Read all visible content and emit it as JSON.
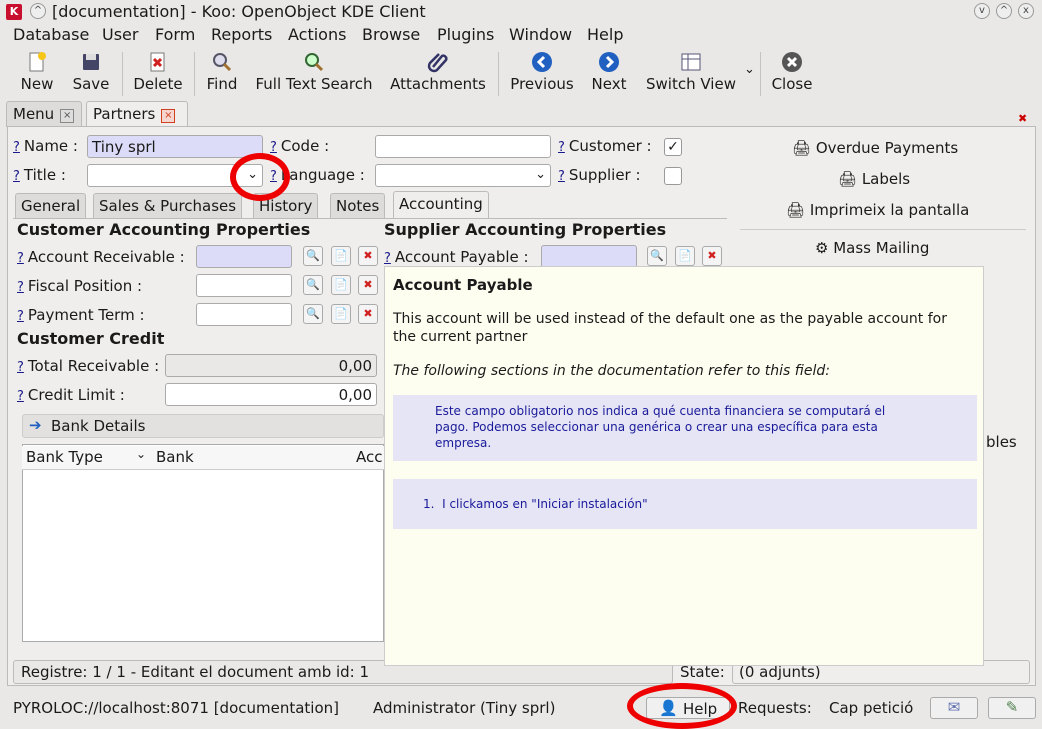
{
  "window": {
    "title": "[documentation] - Koo: OpenObject KDE Client"
  },
  "menu": [
    "Database",
    "User",
    "Form",
    "Reports",
    "Actions",
    "Browse",
    "Plugins",
    "Window",
    "Help"
  ],
  "toolbar": {
    "new": "New",
    "save": "Save",
    "delete": "Delete",
    "find": "Find",
    "full_text_search": "Full Text Search",
    "attachments": "Attachments",
    "previous": "Previous",
    "next": "Next",
    "switch_view": "Switch View",
    "close": "Close"
  },
  "tabs": {
    "menu": "Menu",
    "partners": "Partners"
  },
  "form": {
    "name_label": "Name :",
    "name_value": "Tiny sprl",
    "code_label": "Code :",
    "code_value": "",
    "customer_label": "Customer :",
    "customer_checked": "✓",
    "title_label": "Title :",
    "language_label": "Language :",
    "supplier_label": "Supplier :",
    "q": "?"
  },
  "subtabs": [
    "General",
    "Sales & Purchases",
    "History",
    "Notes",
    "Accounting"
  ],
  "accounting": {
    "customer_heading": "Customer Accounting Properties",
    "account_receivable": "Account Receivable :",
    "fiscal_position": "Fiscal Position :",
    "payment_term": "Payment Term :",
    "supplier_heading": "Supplier Accounting Properties",
    "account_payable": "Account Payable :",
    "credit_heading": "Customer Credit",
    "total_receivable": "Total Receivable :",
    "total_receivable_value": "0,00",
    "credit_limit": "Credit Limit :",
    "credit_limit_value": "0,00",
    "bank_details": "Bank Details",
    "bank_cols": [
      "Bank Type",
      "Bank",
      "Acc"
    ]
  },
  "side": {
    "overdue": "Overdue Payments",
    "labels": "Labels",
    "imprimeix": "Imprimeix la pantalla",
    "mass_mailing": "Mass Mailing",
    "partial_text": "bles"
  },
  "tooltip": {
    "title": "Account Payable",
    "body": "This account will be used instead of the default one as the payable account for the current partner",
    "intro": "The following sections in the documentation refer to this field:",
    "doc1": "Este campo obligatorio nos indica a qué cuenta financiera se computará el pago. Podemos seleccionar una genérica o crear una específica para esta empresa.",
    "doc2_num": "1.",
    "doc2": "I clickamos en \"Iniciar instalación\""
  },
  "record_status": "Registre: 1 / 1 - Editant el document amb id: 1",
  "state_label": "State:",
  "state_value": "(0 adjunts)",
  "status": {
    "server": "PYROLOC://localhost:8071 [documentation]",
    "user": "Administrator (Tiny sprl)",
    "help": "Help",
    "requests_label": "Requests:",
    "requests_value": "Cap petició"
  }
}
